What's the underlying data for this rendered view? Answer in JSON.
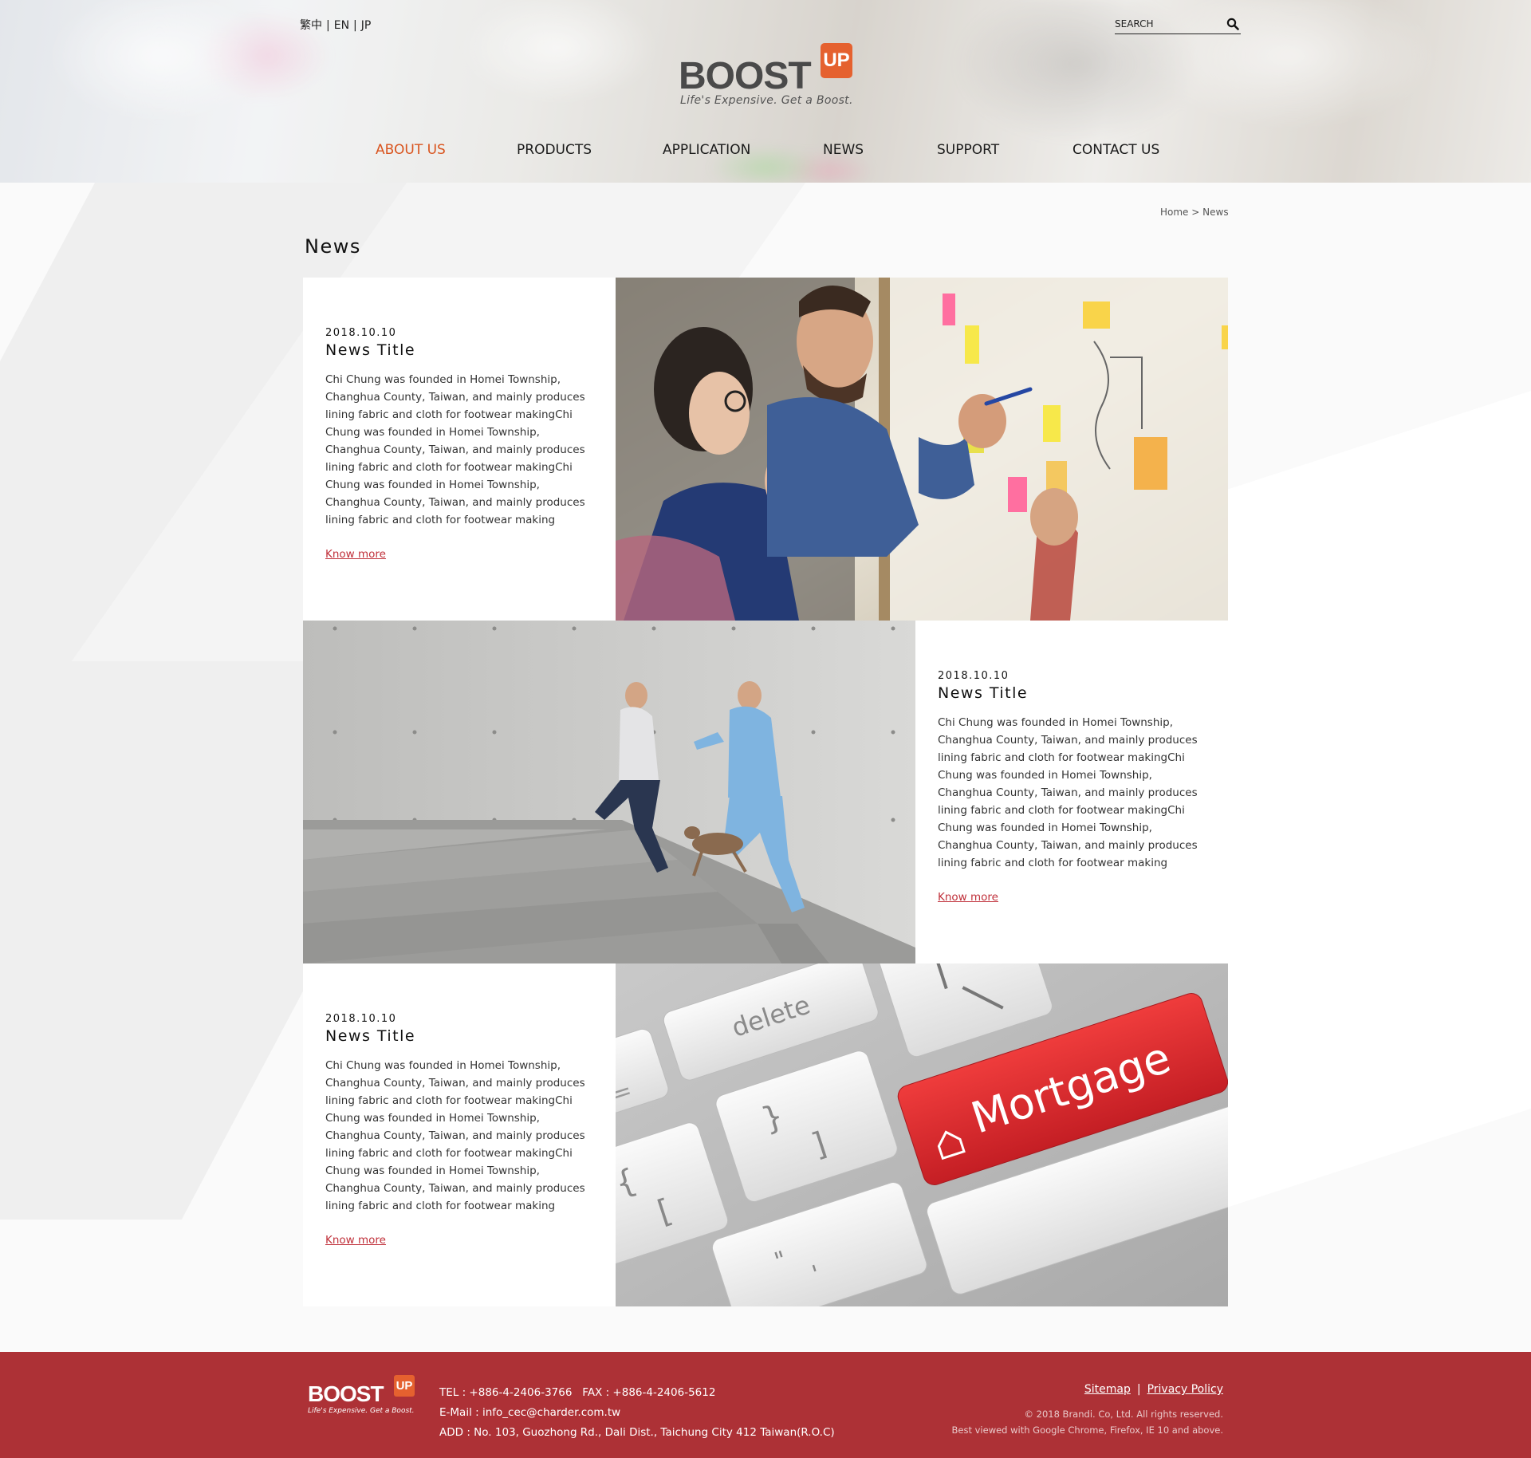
{
  "header": {
    "languages": [
      "繁中",
      "EN",
      "JP"
    ],
    "search_placeholder": "SEARCH",
    "logo": {
      "word": "BOOST",
      "badge": "UP",
      "tagline": "Life's Expensive. Get a Boost."
    },
    "nav": [
      "ABOUT US",
      "PRODUCTS",
      "APPLICATION",
      "NEWS",
      "SUPPORT",
      "CONTACT US"
    ],
    "nav_active": "ABOUT US",
    "accent_color": "#d9541e"
  },
  "breadcrumb": {
    "home": "Home",
    "separator": ">",
    "current": "News"
  },
  "page_title": "News",
  "news": [
    {
      "date": "2018.10.10",
      "title": "News Title",
      "body": "Chi Chung was founded in Homei Township, Changhua County, Taiwan, and mainly produces lining fabric and cloth for footwear makingChi Chung was founded in Homei Township, Changhua County, Taiwan, and mainly produces lining fabric and cloth for footwear makingChi Chung was founded in Homei Township, Changhua County, Taiwan, and mainly produces lining fabric and cloth for footwear making",
      "link": "Know more",
      "image": "team-brainstorm-whiteboard-photo"
    },
    {
      "date": "2018.10.10",
      "title": "News Title",
      "body": "Chi Chung was founded in Homei Township, Changhua County, Taiwan, and mainly produces lining fabric and cloth for footwear makingChi Chung was founded in Homei Township, Changhua County, Taiwan, and mainly produces lining fabric and cloth for footwear makingChi Chung was founded in Homei Township, Changhua County, Taiwan, and mainly produces lining fabric and cloth for footwear making",
      "link": "Know more",
      "image": "businessmen-running-stairs-photo"
    },
    {
      "date": "2018.10.10",
      "title": "News Title",
      "body": "Chi Chung was founded in Homei Township, Changhua County, Taiwan, and mainly produces lining fabric and cloth for footwear makingChi Chung was founded in Homei Township, Changhua County, Taiwan, and mainly produces lining fabric and cloth for footwear makingChi Chung was founded in Homei Township, Changhua County, Taiwan, and mainly produces lining fabric and cloth for footwear making",
      "link": "Know more",
      "image": "mortgage-keyboard-key-photo",
      "photo_keys": {
        "delete": "delete",
        "mortgage": "Mortgage"
      }
    }
  ],
  "footer": {
    "logo": {
      "word": "BOOST",
      "badge": "UP",
      "tagline": "Life's Expensive. Get a Boost."
    },
    "tel": "TEL : +886-4-2406-3766   FAX : +886-4-2406-5612",
    "email": "E-Mail : info_cec@charder.com.tw",
    "address": "ADD : No. 103, Guozhong Rd., Dali Dist., Taichung City 412 Taiwan(R.O.C)",
    "links": [
      "Sitemap",
      "Privacy Policy"
    ],
    "copyright": "© 2018 Brandi. Co, Ltd. All rights reserved.",
    "browser_note": "Best viewed with Google Chrome, Firefox, IE 10 and above.",
    "background_color": "#ad3136"
  }
}
